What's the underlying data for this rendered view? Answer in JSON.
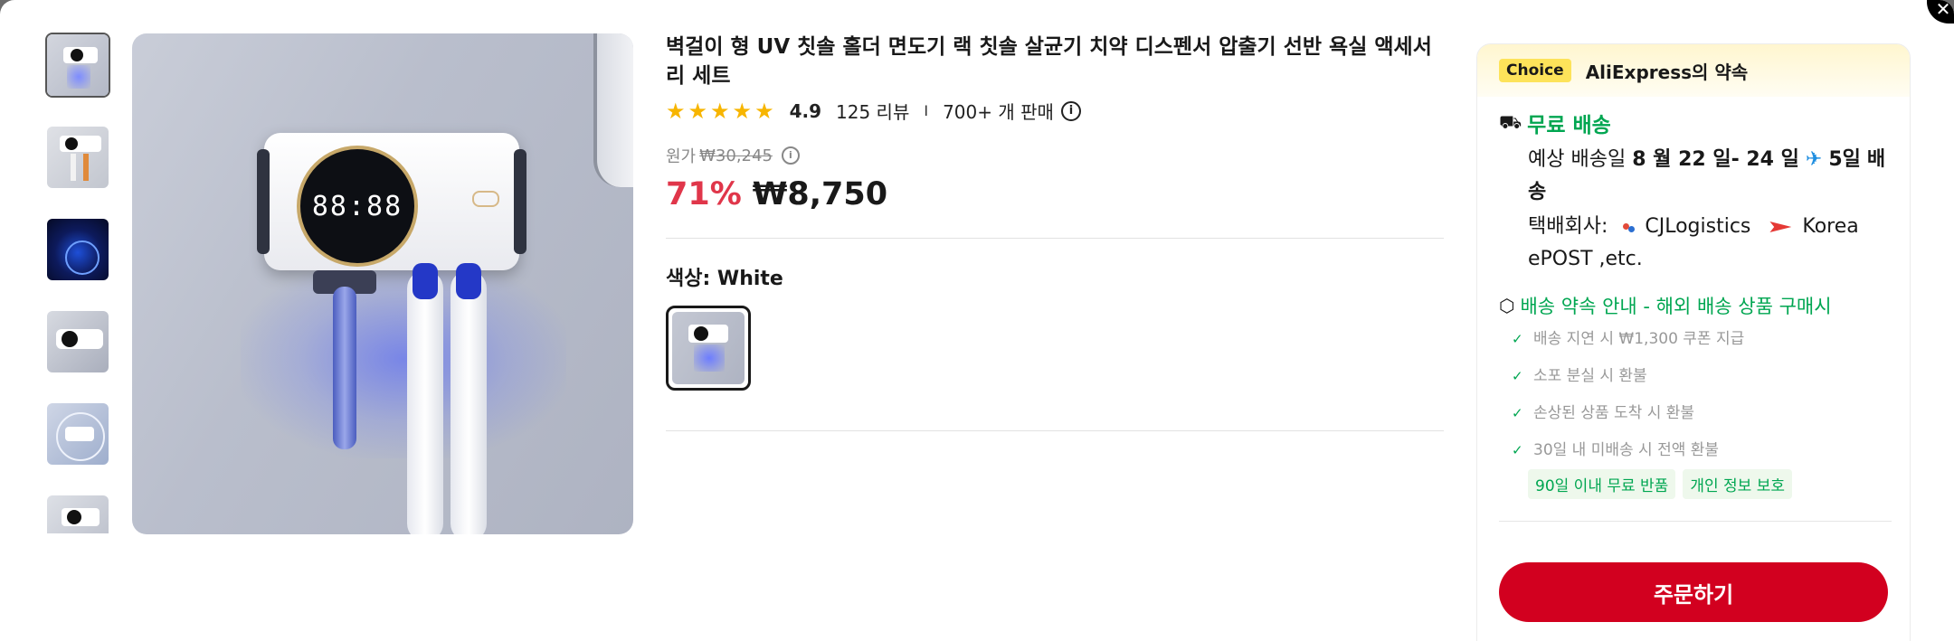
{
  "window": {
    "close_symbol": "✕"
  },
  "gallery": {
    "thumbnails": [
      "thumb-1",
      "thumb-2",
      "thumb-3",
      "thumb-4",
      "thumb-5",
      "thumb-6"
    ],
    "active_index": 0,
    "clock_display": "88:88"
  },
  "product": {
    "title": "벽걸이 형 UV 칫솔 홀더 면도기 랙 칫솔 살균기 치약 디스펜서 압출기 선반 욕실 액세서리 세트",
    "stars": "★★★★★",
    "rating": "4.9",
    "reviews": "125 리뷰",
    "separator": "I",
    "sold": "700+ 개 판매",
    "info_symbol": "i",
    "original_label": "원가",
    "original_price": "₩30,245",
    "discount": "71%",
    "price": "₩8,750",
    "color_label": "색상: White",
    "selected_color": "White"
  },
  "sidebar": {
    "choice_badge": "Choice",
    "choice_text": "AliExpress의 약속",
    "free_shipping": "무료 배송",
    "delivery_prefix": "예상 배송일",
    "delivery_dates": "8 월 22 일- 24 일",
    "delivery_days": "5일",
    "delivery_suffix": "배송",
    "carrier_prefix": "택배회사:",
    "carrier_1": "CJLogistics",
    "carrier_2": "Korea ePOST ,etc.",
    "promise_title": "배송 약속 안내 - 해외 배송 상품 구매시",
    "promises": [
      "배송 지연 시 ₩1,300 쿠폰 지급",
      "소포 분실 시 환불",
      "손상된 상품 도착 시 환불",
      "30일 내 미배송 시 전액 환불"
    ],
    "tags": [
      "90일 이내 무료 반품",
      "개인 정보 보호"
    ],
    "order_button": "주문하기"
  },
  "colors": {
    "accent_red": "#d2001f",
    "discount_red": "#e0364a",
    "green": "#00a651",
    "star": "#f7b500",
    "choice_yellow": "#fde35a"
  },
  "icons": [
    "close-icon",
    "truck-icon",
    "plane-icon",
    "cube-icon",
    "info-icon",
    "check-icon"
  ]
}
